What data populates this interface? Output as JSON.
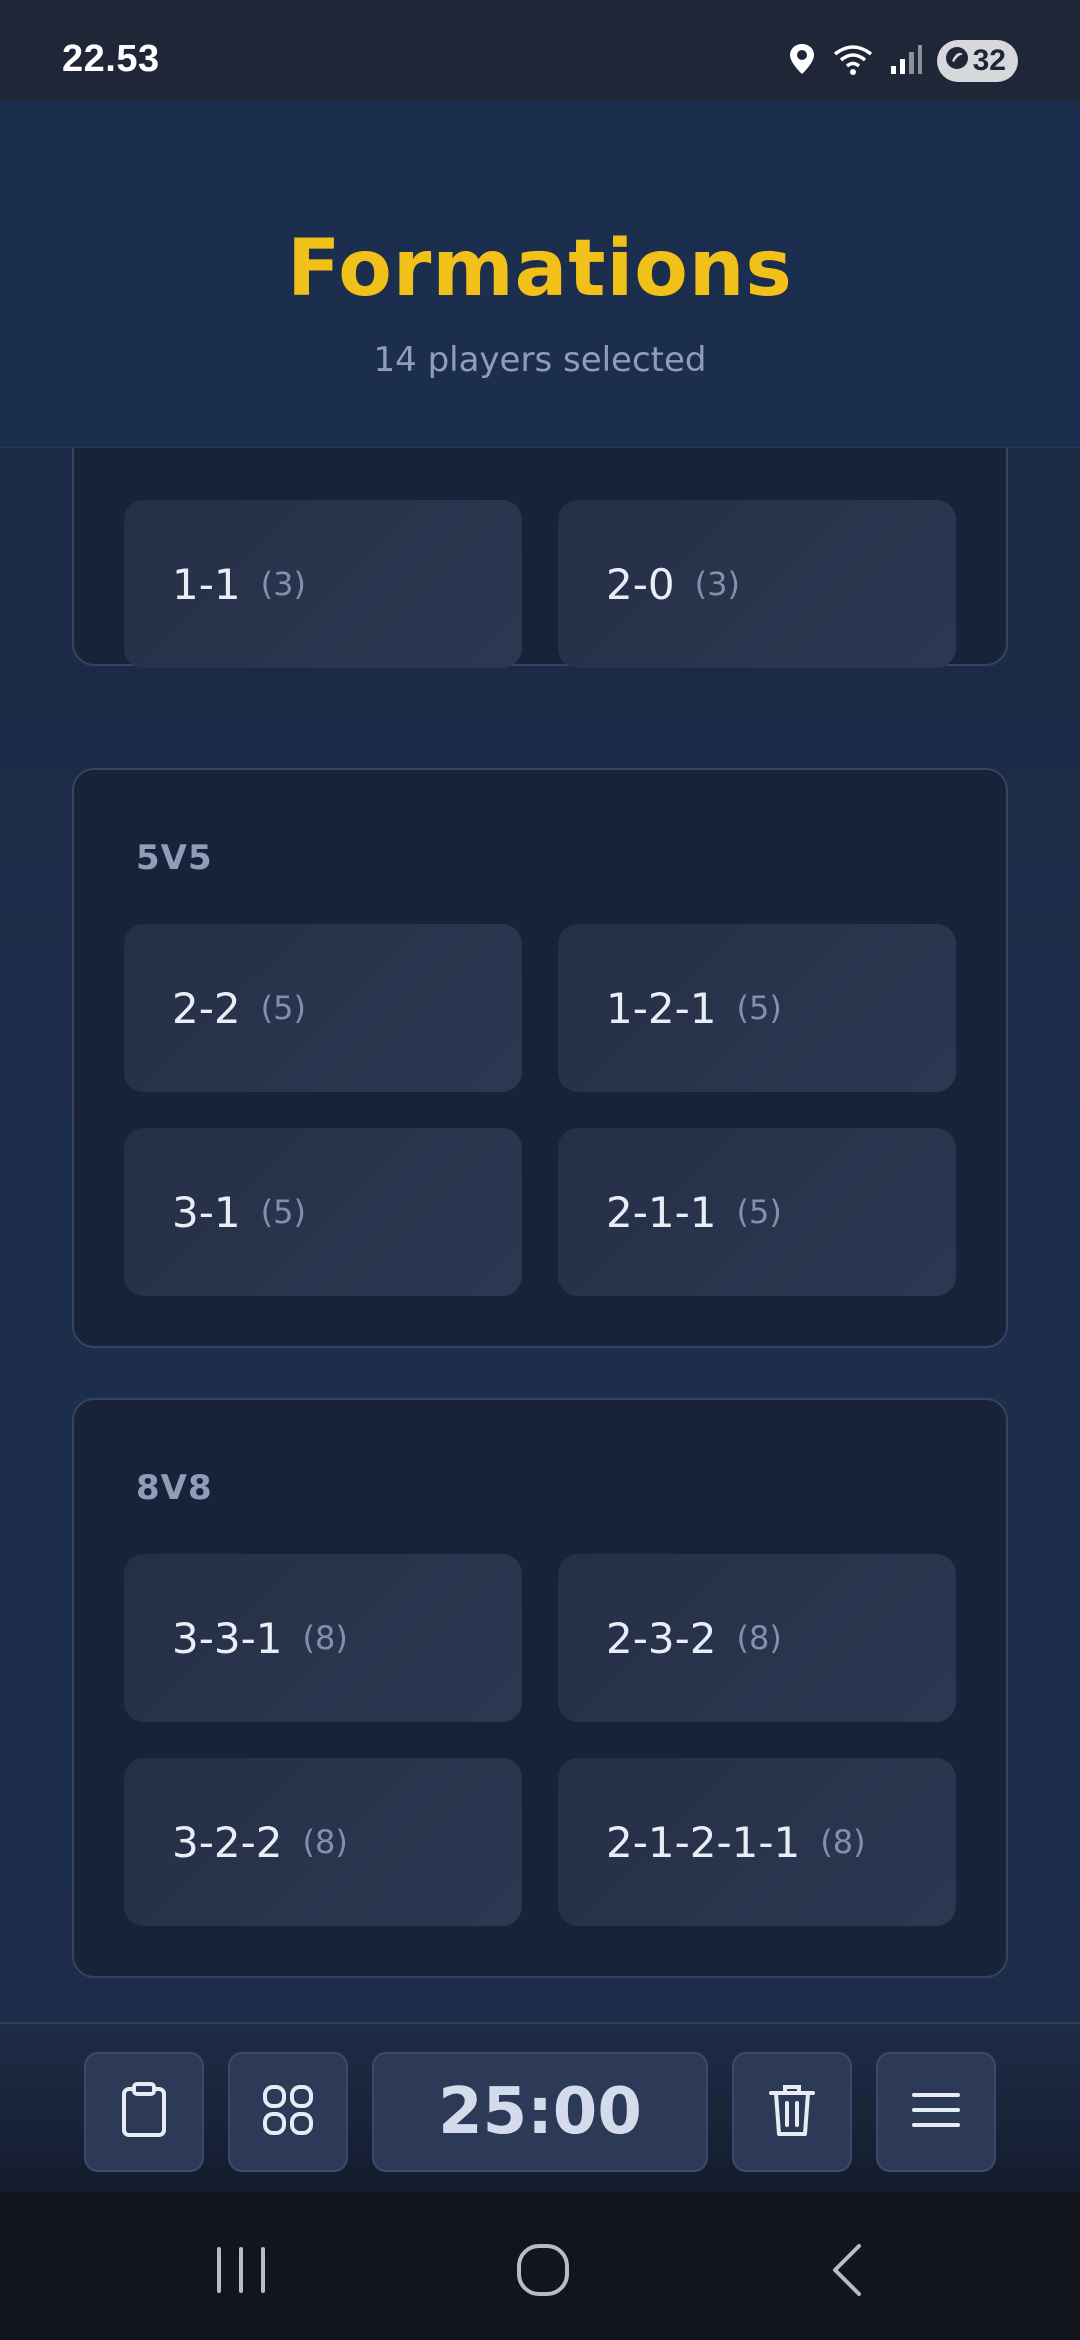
{
  "status_bar": {
    "time": "22.53",
    "battery": "32",
    "icons": [
      "location-icon",
      "wifi-icon",
      "signal-icon",
      "battery-icon"
    ]
  },
  "header": {
    "title": "Formations",
    "subtitle": "14 players selected"
  },
  "sections": [
    {
      "title": "",
      "formations": [
        {
          "name": "1-1",
          "count": "(3)"
        },
        {
          "name": "2-0",
          "count": "(3)"
        }
      ]
    },
    {
      "title": "5V5",
      "formations": [
        {
          "name": "2-2",
          "count": "(5)"
        },
        {
          "name": "1-2-1",
          "count": "(5)"
        },
        {
          "name": "3-1",
          "count": "(5)"
        },
        {
          "name": "2-1-1",
          "count": "(5)"
        }
      ]
    },
    {
      "title": "8V8",
      "formations": [
        {
          "name": "3-3-1",
          "count": "(8)"
        },
        {
          "name": "2-3-2",
          "count": "(8)"
        },
        {
          "name": "3-2-2",
          "count": "(8)"
        },
        {
          "name": "2-1-2-1-1",
          "count": "(8)"
        }
      ]
    }
  ],
  "toolbar": {
    "timer": "25:00",
    "buttons": [
      "clipboard-icon",
      "grid-icon",
      "timer",
      "trash-icon",
      "menu-icon"
    ]
  },
  "navbar": {
    "buttons": [
      "recents-icon",
      "home-icon",
      "back-icon"
    ]
  },
  "colors": {
    "accent": "#f2c119",
    "background": "#1c2b47",
    "card": "#2c3852"
  }
}
